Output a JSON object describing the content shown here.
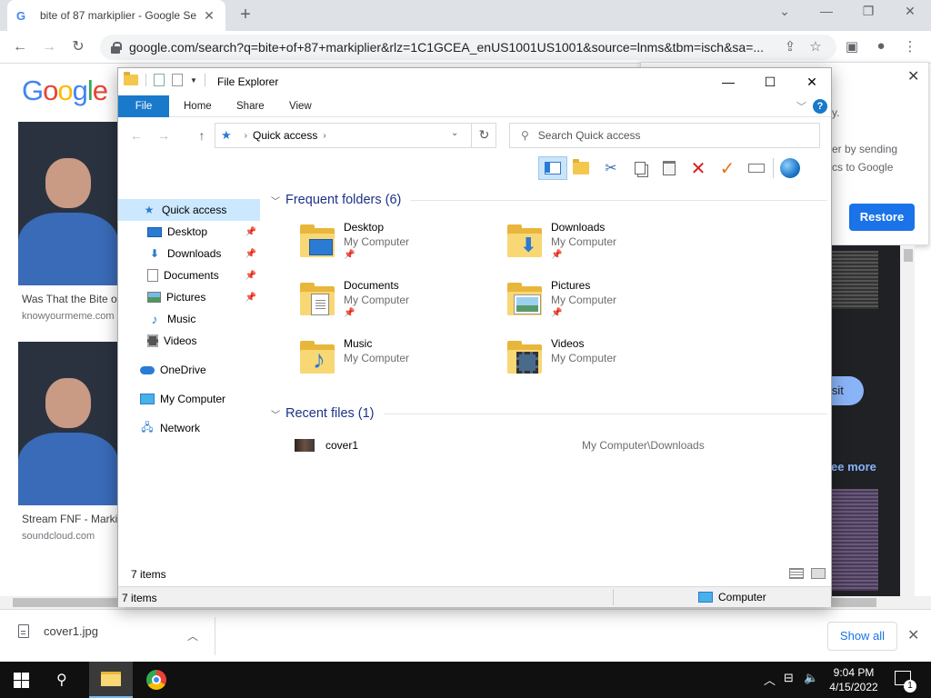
{
  "chrome": {
    "tab_title": "bite of 87 markiplier - Google Se",
    "tab_favicon": "G",
    "url": "google.com/search?q=bite+of+87+markiplier&rlz=1C1GCEA_enUS1001US1001&source=lnms&tbm=isch&sa=..."
  },
  "google": {
    "logo_letters": [
      "G",
      "o",
      "o",
      "g",
      "l",
      "e"
    ],
    "results": [
      {
        "caption": "Was That the Bite o",
        "source": "knowyourmeme.com"
      },
      {
        "caption": "Stream FNF - Marki",
        "source": "soundcloud.com"
      }
    ],
    "popup_line1": "y.",
    "popup_line2": "er by sending",
    "popup_line3": "cs to Google",
    "restore_label": "Restore",
    "visit_label": "isit",
    "see_more_label": "ee more"
  },
  "download": {
    "filename": "cover1.jpg",
    "show_all_label": "Show all"
  },
  "explorer": {
    "title": "File Explorer",
    "ribbon_tabs": [
      "File",
      "Home",
      "Share",
      "View"
    ],
    "breadcrumb": "Quick access",
    "search_placeholder": "Search Quick access",
    "nav": {
      "quick_access": "Quick access",
      "desktop": "Desktop",
      "downloads": "Downloads",
      "documents": "Documents",
      "pictures": "Pictures",
      "music": "Music",
      "videos": "Videos",
      "onedrive": "OneDrive",
      "my_computer": "My Computer",
      "network": "Network"
    },
    "frequent_header": "Frequent folders (6)",
    "folders": [
      {
        "name": "Desktop",
        "location": "My Computer"
      },
      {
        "name": "Downloads",
        "location": "My Computer"
      },
      {
        "name": "Documents",
        "location": "My Computer"
      },
      {
        "name": "Pictures",
        "location": "My Computer"
      },
      {
        "name": "Music",
        "location": "My Computer"
      },
      {
        "name": "Videos",
        "location": "My Computer"
      }
    ],
    "recent_header": "Recent files (1)",
    "recent": [
      {
        "name": "cover1",
        "path": "My Computer\\Downloads"
      }
    ],
    "item_count": "7 items",
    "status_count": "7 items",
    "status_location": "Computer"
  },
  "taskbar": {
    "time": "9:04 PM",
    "date": "4/15/2022",
    "notifications": "1"
  }
}
